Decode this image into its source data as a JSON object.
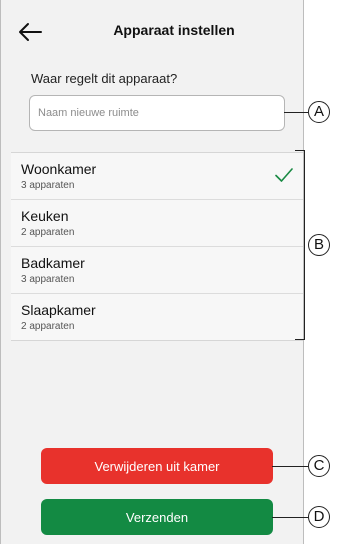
{
  "header": {
    "back_icon": "arrow-left-icon",
    "title": "Apparaat instellen"
  },
  "form": {
    "question": "Waar regelt dit apparaat?",
    "input_placeholder": "Naam nieuwe ruimte",
    "input_value": ""
  },
  "rooms": [
    {
      "name": "Woonkamer",
      "count": "3 apparaten",
      "selected": true
    },
    {
      "name": "Keuken",
      "count": "2 apparaten",
      "selected": false
    },
    {
      "name": "Badkamer",
      "count": "3 apparaten",
      "selected": false
    },
    {
      "name": "Slaapkamer",
      "count": "2 apparaten",
      "selected": false
    }
  ],
  "buttons": {
    "remove_label": "Verwijderen uit kamer",
    "send_label": "Verzenden"
  },
  "callouts": {
    "a": "A",
    "b": "B",
    "c": "C",
    "d": "D"
  },
  "colors": {
    "remove_button": "#e8322c",
    "send_button": "#138a43",
    "check": "#1a8a44"
  }
}
